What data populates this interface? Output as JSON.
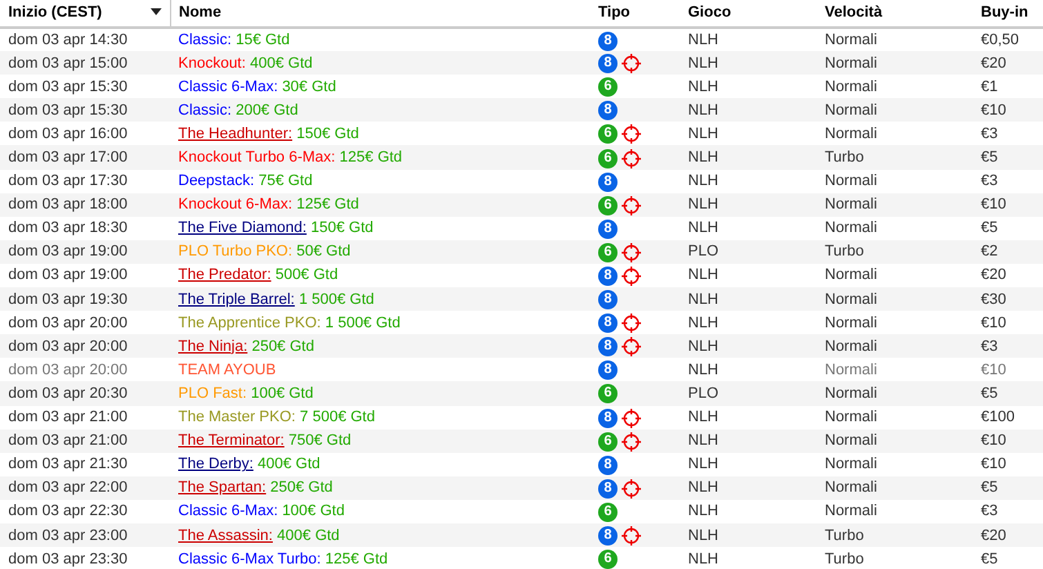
{
  "columns": [
    {
      "label": "Inizio (CEST)",
      "sorted": true
    },
    {
      "label": "Nome",
      "sorted": false
    },
    {
      "label": "Tipo",
      "sorted": false
    },
    {
      "label": "Gioco",
      "sorted": false
    },
    {
      "label": "Velocità",
      "sorted": false
    },
    {
      "label": "Buy-in",
      "sorted": false
    }
  ],
  "rows": [
    {
      "start": "dom 03 apr 14:30",
      "name": {
        "text": "Classic:",
        "color": "#0000ff",
        "underlined": false
      },
      "prize": "15€ Gtd",
      "badge": {
        "seats": "8",
        "color": "#0a64e6"
      },
      "knockout": false,
      "game": "NLH",
      "speed": "Normali",
      "buyin": "€0,50",
      "dimmed": false
    },
    {
      "start": "dom 03 apr 15:00",
      "name": {
        "text": "Knockout:",
        "color": "#ff0000",
        "underlined": false
      },
      "prize": "400€ Gtd",
      "badge": {
        "seats": "8",
        "color": "#0a64e6"
      },
      "knockout": true,
      "game": "NLH",
      "speed": "Normali",
      "buyin": "€20",
      "dimmed": false
    },
    {
      "start": "dom 03 apr 15:30",
      "name": {
        "text": "Classic 6-Max:",
        "color": "#0000ff",
        "underlined": false
      },
      "prize": "30€ Gtd",
      "badge": {
        "seats": "6",
        "color": "#1fa81f"
      },
      "knockout": false,
      "game": "NLH",
      "speed": "Normali",
      "buyin": "€1",
      "dimmed": false
    },
    {
      "start": "dom 03 apr 15:30",
      "name": {
        "text": "Classic:",
        "color": "#0000ff",
        "underlined": false
      },
      "prize": "200€ Gtd",
      "badge": {
        "seats": "8",
        "color": "#0a64e6"
      },
      "knockout": false,
      "game": "NLH",
      "speed": "Normali",
      "buyin": "€10",
      "dimmed": false
    },
    {
      "start": "dom 03 apr 16:00",
      "name": {
        "text": "The Headhunter:",
        "color": "#cc0000",
        "underlined": true
      },
      "prize": "150€ Gtd",
      "badge": {
        "seats": "6",
        "color": "#1fa81f"
      },
      "knockout": true,
      "game": "NLH",
      "speed": "Normali",
      "buyin": "€3",
      "dimmed": false
    },
    {
      "start": "dom 03 apr 17:00",
      "name": {
        "text": "Knockout Turbo 6-Max:",
        "color": "#ff0000",
        "underlined": false
      },
      "prize": "125€ Gtd",
      "badge": {
        "seats": "6",
        "color": "#1fa81f"
      },
      "knockout": true,
      "game": "NLH",
      "speed": "Turbo",
      "buyin": "€5",
      "dimmed": false
    },
    {
      "start": "dom 03 apr 17:30",
      "name": {
        "text": "Deepstack:",
        "color": "#0000ff",
        "underlined": false
      },
      "prize": "75€ Gtd",
      "badge": {
        "seats": "8",
        "color": "#0a64e6"
      },
      "knockout": false,
      "game": "NLH",
      "speed": "Normali",
      "buyin": "€3",
      "dimmed": false
    },
    {
      "start": "dom 03 apr 18:00",
      "name": {
        "text": "Knockout 6-Max:",
        "color": "#ff0000",
        "underlined": false
      },
      "prize": "125€ Gtd",
      "badge": {
        "seats": "6",
        "color": "#1fa81f"
      },
      "knockout": true,
      "game": "NLH",
      "speed": "Normali",
      "buyin": "€10",
      "dimmed": false
    },
    {
      "start": "dom 03 apr 18:30",
      "name": {
        "text": "The Five Diamond:",
        "color": "#000080",
        "underlined": true
      },
      "prize": "150€ Gtd",
      "badge": {
        "seats": "8",
        "color": "#0a64e6"
      },
      "knockout": false,
      "game": "NLH",
      "speed": "Normali",
      "buyin": "€5",
      "dimmed": false
    },
    {
      "start": "dom 03 apr 19:00",
      "name": {
        "text": "PLO Turbo PKO:",
        "color": "#ff9900",
        "underlined": false
      },
      "prize": "50€ Gtd",
      "badge": {
        "seats": "6",
        "color": "#1fa81f"
      },
      "knockout": true,
      "game": "PLO",
      "speed": "Turbo",
      "buyin": "€2",
      "dimmed": false
    },
    {
      "start": "dom 03 apr 19:00",
      "name": {
        "text": "The Predator:",
        "color": "#cc0000",
        "underlined": true
      },
      "prize": "500€ Gtd",
      "badge": {
        "seats": "8",
        "color": "#0a64e6"
      },
      "knockout": true,
      "game": "NLH",
      "speed": "Normali",
      "buyin": "€20",
      "dimmed": false
    },
    {
      "start": "dom 03 apr 19:30",
      "name": {
        "text": "The Triple Barrel:",
        "color": "#000080",
        "underlined": true
      },
      "prize": "1 500€ Gtd",
      "badge": {
        "seats": "8",
        "color": "#0a64e6"
      },
      "knockout": false,
      "game": "NLH",
      "speed": "Normali",
      "buyin": "€30",
      "dimmed": false
    },
    {
      "start": "dom 03 apr 20:00",
      "name": {
        "text": "The Apprentice PKO:",
        "color": "#999922",
        "underlined": false
      },
      "prize": "1 500€ Gtd",
      "badge": {
        "seats": "8",
        "color": "#0a64e6"
      },
      "knockout": true,
      "game": "NLH",
      "speed": "Normali",
      "buyin": "€10",
      "dimmed": false
    },
    {
      "start": "dom 03 apr 20:00",
      "name": {
        "text": "The Ninja:",
        "color": "#cc0000",
        "underlined": true
      },
      "prize": "250€ Gtd",
      "badge": {
        "seats": "8",
        "color": "#0a64e6"
      },
      "knockout": true,
      "game": "NLH",
      "speed": "Normali",
      "buyin": "€3",
      "dimmed": false
    },
    {
      "start": "dom 03 apr 20:00",
      "name": {
        "text": "TEAM AYOUB",
        "color": "#ff5533",
        "underlined": false
      },
      "badge": {
        "seats": "8",
        "color": "#0a64e6"
      },
      "knockout": false,
      "game": "NLH",
      "speed": "Normali",
      "buyin": "€10",
      "dimmed": true
    },
    {
      "start": "dom 03 apr 20:30",
      "name": {
        "text": "PLO Fast:",
        "color": "#ff9900",
        "underlined": false
      },
      "prize": "100€ Gtd",
      "badge": {
        "seats": "6",
        "color": "#1fa81f"
      },
      "knockout": false,
      "game": "PLO",
      "speed": "Normali",
      "buyin": "€5",
      "dimmed": false
    },
    {
      "start": "dom 03 apr 21:00",
      "name": {
        "text": "The Master PKO:",
        "color": "#999922",
        "underlined": false
      },
      "prize": "7 500€ Gtd",
      "badge": {
        "seats": "8",
        "color": "#0a64e6"
      },
      "knockout": true,
      "game": "NLH",
      "speed": "Normali",
      "buyin": "€100",
      "dimmed": false
    },
    {
      "start": "dom 03 apr 21:00",
      "name": {
        "text": "The Terminator:",
        "color": "#cc0000",
        "underlined": true
      },
      "prize": "750€ Gtd",
      "badge": {
        "seats": "6",
        "color": "#1fa81f"
      },
      "knockout": true,
      "game": "NLH",
      "speed": "Normali",
      "buyin": "€10",
      "dimmed": false
    },
    {
      "start": "dom 03 apr 21:30",
      "name": {
        "text": "The Derby:",
        "color": "#000080",
        "underlined": true
      },
      "prize": "400€ Gtd",
      "badge": {
        "seats": "8",
        "color": "#0a64e6"
      },
      "knockout": false,
      "game": "NLH",
      "speed": "Normali",
      "buyin": "€10",
      "dimmed": false
    },
    {
      "start": "dom 03 apr 22:00",
      "name": {
        "text": "The Spartan:",
        "color": "#cc0000",
        "underlined": true
      },
      "prize": "250€ Gtd",
      "badge": {
        "seats": "8",
        "color": "#0a64e6"
      },
      "knockout": true,
      "game": "NLH",
      "speed": "Normali",
      "buyin": "€5",
      "dimmed": false
    },
    {
      "start": "dom 03 apr 22:30",
      "name": {
        "text": "Classic 6-Max:",
        "color": "#0000ff",
        "underlined": false
      },
      "prize": "100€ Gtd",
      "badge": {
        "seats": "6",
        "color": "#1fa81f"
      },
      "knockout": false,
      "game": "NLH",
      "speed": "Normali",
      "buyin": "€3",
      "dimmed": false
    },
    {
      "start": "dom 03 apr 23:00",
      "name": {
        "text": "The Assassin:",
        "color": "#cc0000",
        "underlined": true
      },
      "prize": "400€ Gtd",
      "badge": {
        "seats": "8",
        "color": "#0a64e6"
      },
      "knockout": true,
      "game": "NLH",
      "speed": "Turbo",
      "buyin": "€20",
      "dimmed": false
    },
    {
      "start": "dom 03 apr 23:30",
      "name": {
        "text": "Classic 6-Max Turbo:",
        "color": "#0000ff",
        "underlined": false
      },
      "prize": "125€ Gtd",
      "badge": {
        "seats": "6",
        "color": "#1fa81f"
      },
      "knockout": false,
      "game": "NLH",
      "speed": "Turbo",
      "buyin": "€5",
      "dimmed": false
    }
  ]
}
